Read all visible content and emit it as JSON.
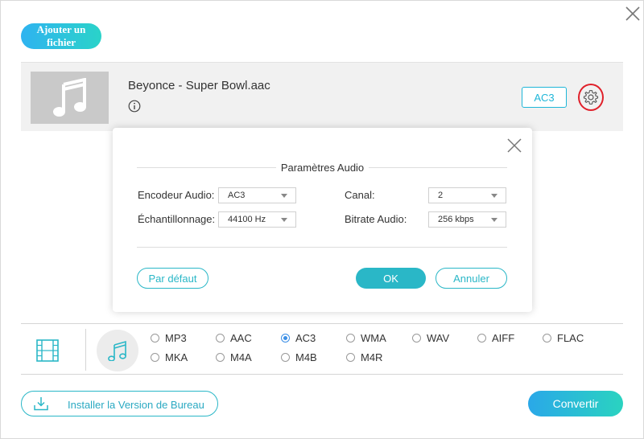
{
  "toolbar": {
    "add_file_label": "Ajouter un fichier"
  },
  "file": {
    "name": "Beyonce - Super Bowl.aac",
    "format_badge": "AC3"
  },
  "dialog": {
    "title": "Paramètres Audio",
    "encoder_label": "Encodeur Audio:",
    "encoder_value": "AC3",
    "samplerate_label": "Échantillonnage:",
    "samplerate_value": "44100 Hz",
    "channel_label": "Canal:",
    "channel_value": "2",
    "bitrate_label": "Bitrate Audio:",
    "bitrate_value": "256 kbps",
    "default_button": "Par défaut",
    "ok_button": "OK",
    "cancel_button": "Annuler"
  },
  "formats": {
    "selected": "AC3",
    "row1": [
      "MP3",
      "AAC",
      "AC3",
      "WMA",
      "WAV",
      "AIFF",
      "FLAC"
    ],
    "row2": [
      "MKA",
      "M4A",
      "M4B",
      "M4R"
    ]
  },
  "footer": {
    "install_label": "Installer la Version de Bureau",
    "convert_label": "Convertir"
  },
  "colors": {
    "accent": "#2ab7c7",
    "highlight_ring": "#e0202a",
    "radio_selected": "#3a8ee6"
  }
}
